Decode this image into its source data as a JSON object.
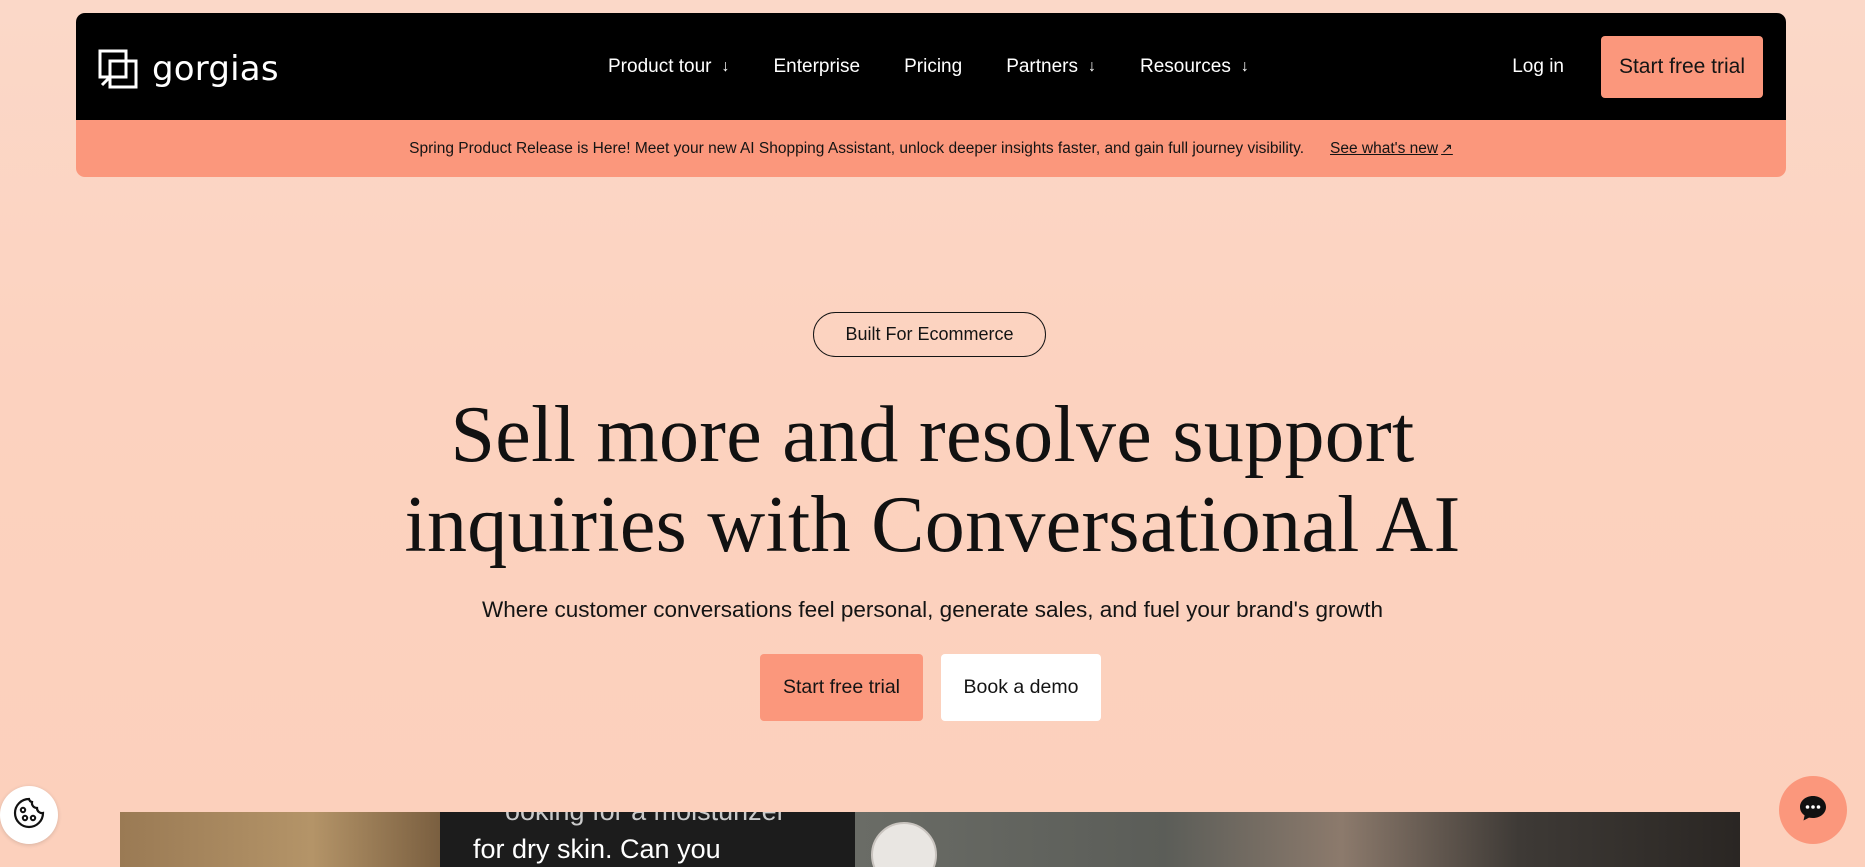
{
  "brand": {
    "name": "gorgias",
    "accent_color": "#fb977c",
    "nav_bg": "#000000"
  },
  "nav": {
    "items": [
      {
        "label": "Product tour",
        "has_dropdown": true
      },
      {
        "label": "Enterprise",
        "has_dropdown": false
      },
      {
        "label": "Pricing",
        "has_dropdown": false
      },
      {
        "label": "Partners",
        "has_dropdown": true
      },
      {
        "label": "Resources",
        "has_dropdown": true
      }
    ],
    "dropdown_glyph": "↓",
    "login_label": "Log in",
    "cta_label": "Start free trial"
  },
  "banner": {
    "text": "Spring Product Release is Here! Meet your new AI Shopping Assistant, unlock deeper insights faster, and gain full journey visibility.",
    "link_label": "See what's new",
    "link_glyph": "↗"
  },
  "hero": {
    "pill_label": "Built For Ecommerce",
    "headline_line1": "Sell more and resolve support",
    "headline_line2": "inquiries with Conversational AI",
    "subheadline": "Where customer conversations feel personal, generate sales, and fuel your brand's growth",
    "primary_cta": "Start free trial",
    "secondary_cta": "Book a demo"
  },
  "video_preview": {
    "chat_text_faded": "ooking for a moisturizer",
    "chat_text_line2": "for dry skin. Can you"
  },
  "icons": {
    "cookie": "cookie-icon",
    "chat": "chat-bubble-icon",
    "logo": "gorgias-logo-icon"
  }
}
